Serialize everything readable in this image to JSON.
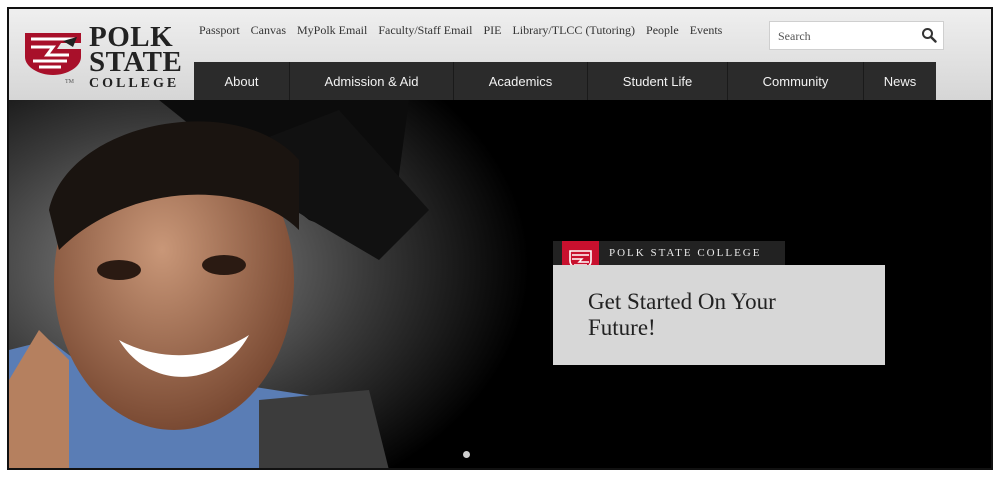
{
  "logo": {
    "line1": "POLK",
    "line2": "STATE",
    "line3": "COLLEGE",
    "tm": "TM"
  },
  "utility_links": [
    "Passport",
    "Canvas",
    "MyPolk Email",
    "Faculty/Staff Email",
    "PIE",
    "Library/TLCC (Tutoring)",
    "People",
    "Events"
  ],
  "search": {
    "placeholder": "Search",
    "icon": "search-icon"
  },
  "nav": [
    "About",
    "Admission & Aid",
    "Academics",
    "Student Life",
    "Community",
    "News"
  ],
  "hero": {
    "badge": "POLK STATE COLLEGE",
    "title": "Get Started On Your Future!"
  },
  "colors": {
    "brand_red": "#c8102e",
    "nav_bg": "#2b2b2b",
    "callout_bg": "#d7d7d7"
  }
}
